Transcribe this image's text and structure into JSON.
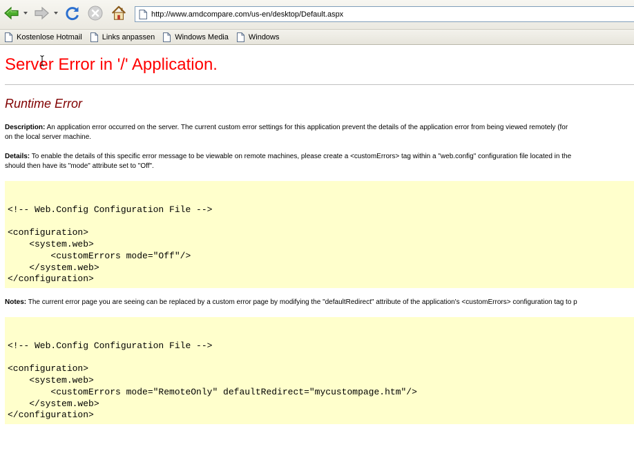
{
  "browser": {
    "address": "http://www.amdcompare.com/us-en/desktop/Default.aspx",
    "bookmarks": [
      "Kostenlose Hotmail",
      "Links anpassen",
      "Windows Media",
      "Windows"
    ]
  },
  "error_page": {
    "title": "Server Error in '/' Application.",
    "subtitle": "Runtime Error",
    "description_label": "Description:",
    "description_text": " An application error occurred on the server. The current custom error settings for this application prevent the details of the application error from being viewed remotely (for",
    "description_text_2": "on the local server machine.",
    "details_label": "Details:",
    "details_text": " To enable the details of this specific error message to be viewable on remote machines, please create a <customErrors> tag within a \"web.config\" configuration file located in the",
    "details_text_2": "should then have its \"mode\" attribute set to \"Off\".",
    "code1": "\n\n<!-- Web.Config Configuration File -->\n\n<configuration>\n    <system.web>\n        <customErrors mode=\"Off\"/>\n    </system.web>\n</configuration>",
    "notes_label": "Notes:",
    "notes_text": " The current error page you are seeing can be replaced by a custom error page by modifying the \"defaultRedirect\" attribute of the application's <customErrors> configuration tag to p",
    "code2": "\n\n<!-- Web.Config Configuration File -->\n\n<configuration>\n    <system.web>\n        <customErrors mode=\"RemoteOnly\" defaultRedirect=\"mycustompage.htm\"/>\n    </system.web>\n</configuration>"
  },
  "colors": {
    "title": "#ff0000",
    "subtitle": "#800000",
    "code_background": "#ffffcc"
  },
  "icons": [
    "back-arrow-icon",
    "forward-arrow-icon",
    "refresh-icon",
    "stop-icon",
    "home-icon",
    "page-icon",
    "bookmark-page-icon"
  ]
}
